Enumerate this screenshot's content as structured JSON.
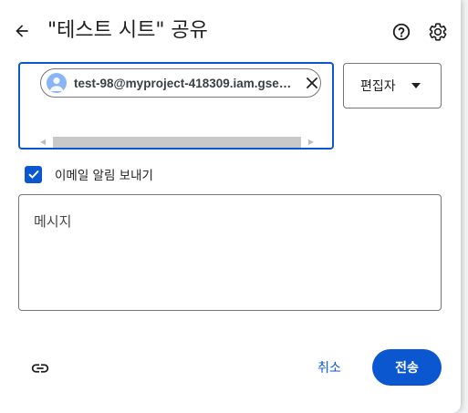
{
  "dialog": {
    "title": "\"테스트 시트\" 공유",
    "back_icon": "arrow-back-icon",
    "help_icon": "help-circle-icon",
    "settings_icon": "gear-icon"
  },
  "recipients": {
    "chip": {
      "email": "test-98@myproject-418309.iam.gse…",
      "avatar_icon": "person-avatar-icon",
      "close_icon": "close-icon"
    }
  },
  "role": {
    "selected": "편집자",
    "caret_icon": "caret-down-icon"
  },
  "notify": {
    "checked": true,
    "label": "이메일 알림 보내기"
  },
  "message": {
    "placeholder": "메시지"
  },
  "footer": {
    "link_icon": "link-icon",
    "cancel_label": "취소",
    "send_label": "전송"
  },
  "colors": {
    "accent": "#0b57d0",
    "border": "#747775",
    "text": "#1f1f1f"
  }
}
